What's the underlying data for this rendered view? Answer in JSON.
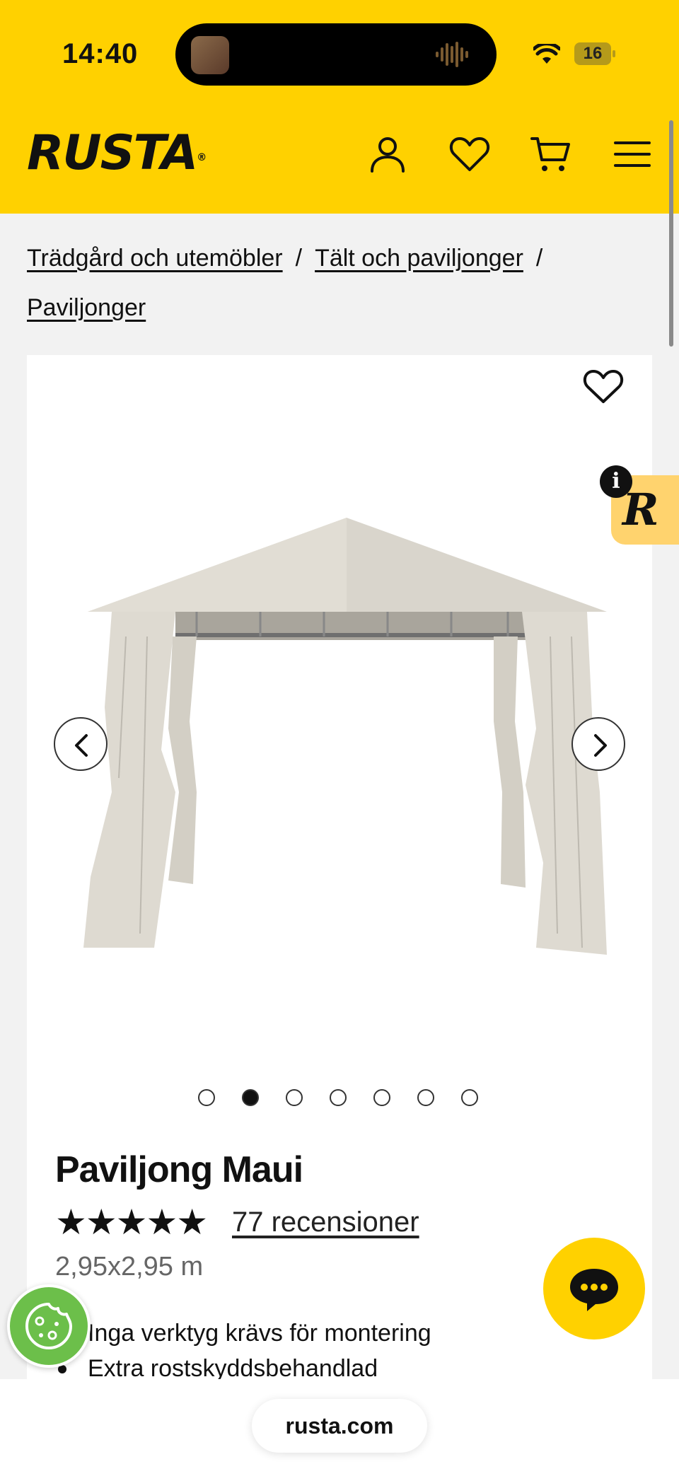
{
  "status_bar": {
    "time": "14:40",
    "battery": "16"
  },
  "header": {
    "logo": "RUSTA",
    "logo_mark": "®",
    "colors": {
      "brand_yellow": "#ffd100"
    },
    "icons": [
      "user-icon",
      "heart-icon",
      "cart-icon",
      "menu-icon"
    ]
  },
  "breadcrumbs": [
    {
      "label": "Trädgård och utemöbler"
    },
    {
      "label": "Tält och paviljonger"
    },
    {
      "label": "Paviljonger"
    }
  ],
  "breadcrumb_separator": "/",
  "product": {
    "name": "Paviljong Maui",
    "rating_stars": "★★★★★",
    "rating": 5,
    "reviews_label": "77 recensioner",
    "size": "2,95x2,95 m",
    "bullets": [
      "Inga verktyg krävs för montering",
      "Extra rostskyddsbehandlad"
    ],
    "gallery": {
      "image_count": 7,
      "active_index": 1
    }
  },
  "widgets": {
    "reco_badge": "R",
    "info": "i"
  },
  "browser": {
    "url": "rusta.com"
  }
}
